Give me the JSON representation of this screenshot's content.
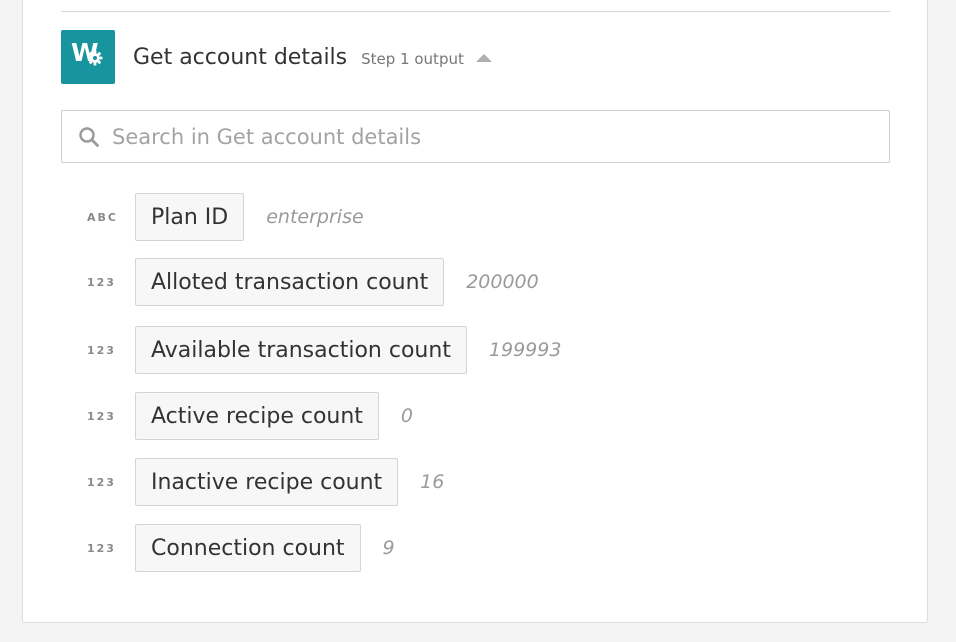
{
  "step": {
    "title": "Get account details",
    "label": "Step 1 output",
    "logo_letter": "W"
  },
  "search": {
    "placeholder": "Search in Get account details",
    "value": ""
  },
  "fields": [
    {
      "type": "ABC",
      "name": "Plan ID",
      "value": "enterprise"
    },
    {
      "type": "123",
      "name": "Alloted transaction count",
      "value": "200000"
    },
    {
      "type": "123",
      "name": "Available transaction count",
      "value": "199993"
    },
    {
      "type": "123",
      "name": "Active recipe count",
      "value": "0"
    },
    {
      "type": "123",
      "name": "Inactive recipe count",
      "value": "16"
    },
    {
      "type": "123",
      "name": "Connection count",
      "value": "9"
    }
  ],
  "colors": {
    "accent": "#17949e",
    "pill_background": "#f7f7f7",
    "value_text": "#9a9a9a"
  }
}
